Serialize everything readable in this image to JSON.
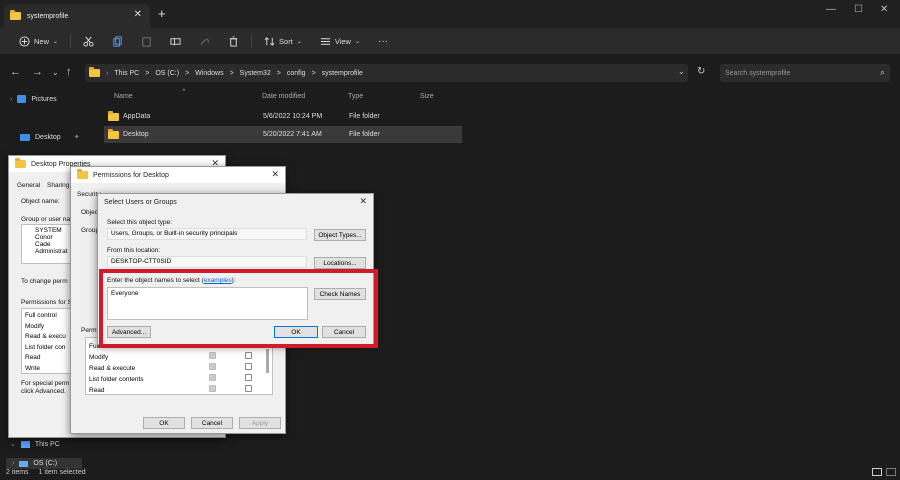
{
  "window": {
    "tab_title": "systemprofile",
    "new_tab": "+",
    "minimize": "—",
    "maximize": "☐",
    "close": "✕"
  },
  "toolbar": {
    "new_label": "New",
    "sort_label": "Sort",
    "view_label": "View",
    "more": "···"
  },
  "address": {
    "crumbs": [
      "This PC",
      ">",
      "OS (C:)",
      ">",
      "Windows",
      ">",
      "System32",
      ">",
      "config",
      ">",
      "systemprofile"
    ],
    "search_placeholder": "Search systemprofile"
  },
  "sidebar": {
    "pictures": "Pictures",
    "desktop": "Desktop",
    "this_pc": "This PC",
    "os_c": "OS (C:)"
  },
  "columns": {
    "name": "Name",
    "date": "Date modified",
    "type": "Type",
    "size": "Size"
  },
  "files": [
    {
      "name": "AppData",
      "date": "5/6/2022 10:24 PM",
      "type": "File folder"
    },
    {
      "name": "Desktop",
      "date": "5/20/2022 7:41 AM",
      "type": "File folder"
    }
  ],
  "status": {
    "items": "2 items",
    "selected": "1 item selected"
  },
  "props_dialog": {
    "title": "Desktop Properties",
    "tab_general": "General",
    "tab_sharing": "Sharing",
    "object_name": "Object name:",
    "group_label": "Group or user na",
    "users": [
      "SYSTEM",
      "Conor Cade",
      "Administrat"
    ],
    "change_perm": "To change perm",
    "perms_for": "Permissions for S",
    "perms": [
      "Full control",
      "Modify",
      "Read & execu",
      "List folder con",
      "Read",
      "Write"
    ],
    "special1": "For special perm",
    "special2": "click Advanced."
  },
  "perm_dialog": {
    "title": "Permissions for Desktop",
    "security": "Security",
    "object": "Object",
    "group": "Group",
    "perm_label": "Permi",
    "perms": [
      "Full",
      "Modify",
      "Read & execute",
      "List folder contents",
      "Read"
    ],
    "ok": "OK",
    "cancel": "Cancel",
    "apply": "Apply"
  },
  "select_dialog": {
    "title": "Select Users or Groups",
    "obj_type_label": "Select this object type:",
    "obj_type_value": "Users, Groups, or Built-in security principals",
    "object_types_btn": "Object Types...",
    "location_label": "From this location:",
    "location_value": "DESKTOP-CTT0SID",
    "locations_btn": "Locations...",
    "enter_label": "Enter the object names to select (",
    "examples": "examples",
    "enter_label_end": "):",
    "input_value": "Everyone",
    "check_names": "Check Names",
    "advanced": "Advanced...",
    "ok": "OK",
    "cancel": "Cancel"
  },
  "colors": {
    "highlight": "#d11a2a",
    "folder": "#f4c542",
    "accent": "#0078d4"
  }
}
